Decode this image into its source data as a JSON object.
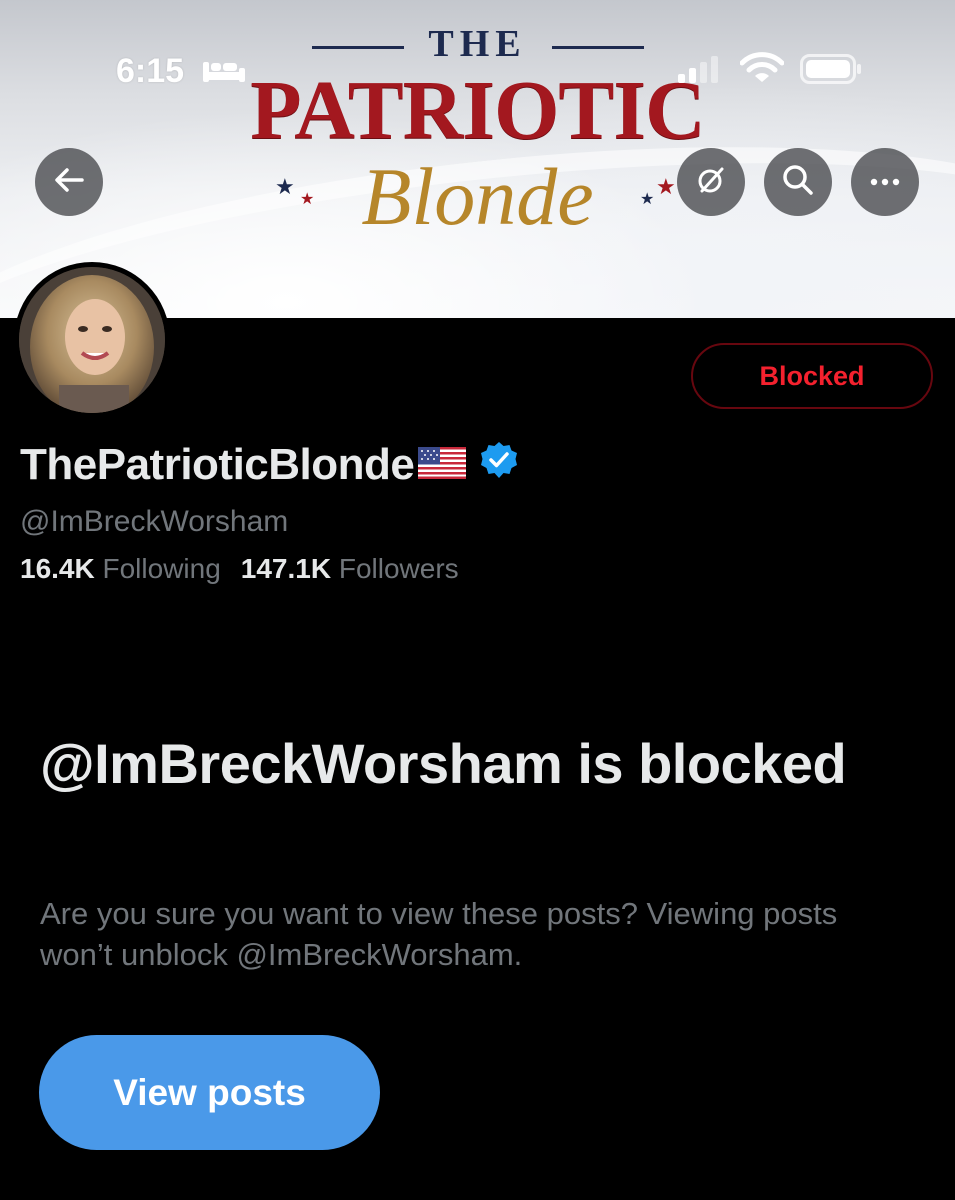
{
  "status_bar": {
    "time": "6:15",
    "sleep_icon": "bed-icon",
    "signal_icon": "cellular-signal-icon",
    "wifi_icon": "wifi-icon",
    "battery_icon": "battery-icon"
  },
  "banner": {
    "logo_top": "THE",
    "logo_main": "PATRIOTIC",
    "logo_script": "Blonde",
    "colors": {
      "navy": "#1d2a4f",
      "red": "#a3181f",
      "gold": "#b6862a"
    }
  },
  "header_actions": {
    "back_icon": "arrow-left-icon",
    "grok_icon": "grok-slash-icon",
    "search_icon": "search-icon",
    "more_icon": "more-horizontal-icon"
  },
  "profile": {
    "display_name": "ThePatrioticBlonde",
    "flag_icon": "us-flag-icon",
    "verified_icon": "verified-badge-icon",
    "handle": "@ImBreckWorsham",
    "following_count": "16.4K",
    "following_label": "Following",
    "followers_count": "147.1K",
    "followers_label": "Followers",
    "blocked_button_label": "Blocked"
  },
  "blocked_notice": {
    "title": "@ImBreckWorsham is blocked",
    "description": "Are you sure you want to view these posts? Viewing posts won’t unblock @ImBreckWorsham.",
    "view_posts_label": "View posts"
  },
  "colors": {
    "background": "#000000",
    "primary_text": "#e7e9ea",
    "secondary_text": "#71767b",
    "blocked_red": "#f4212e",
    "accent_blue": "#4a99e9",
    "verified_blue": "#1d9bf0"
  }
}
